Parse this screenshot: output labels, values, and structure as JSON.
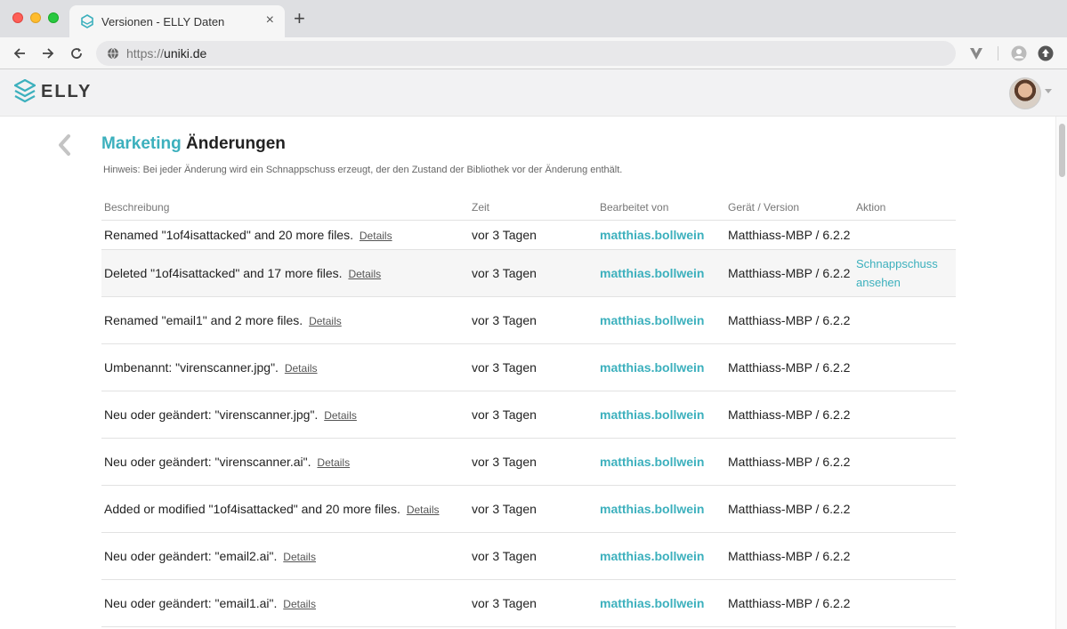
{
  "browser": {
    "tab_title": "Versionen - ELLY Daten",
    "url_scheme": "https://",
    "url_host": "uniki.de"
  },
  "app": {
    "logo_text": "ELLY"
  },
  "page": {
    "library": "Marketing",
    "title": "Änderungen",
    "hint": "Hinweis: Bei jeder Änderung wird ein Schnappschuss erzeugt, der den Zustand der Bibliothek vor der Änderung enthält."
  },
  "table": {
    "headers": {
      "description": "Beschreibung",
      "time": "Zeit",
      "editor": "Bearbeitet von",
      "device": "Gerät / Version",
      "action": "Aktion"
    },
    "details_label": "Details",
    "rows": [
      {
        "description": "Renamed \"1of4isattacked\" and 20 more files.",
        "time": "vor 3 Tagen",
        "editor": "matthias.bollwein",
        "device": "Matthiass-MBP / 6.2.2",
        "action": ""
      },
      {
        "description": "Deleted \"1of4isattacked\" and 17 more files.",
        "time": "vor 3 Tagen",
        "editor": "matthias.bollwein",
        "device": "Matthiass-MBP / 6.2.2",
        "action": "Schnappschuss ansehen"
      },
      {
        "description": "Renamed \"email1\" and 2 more files.",
        "time": "vor 3 Tagen",
        "editor": "matthias.bollwein",
        "device": "Matthiass-MBP / 6.2.2",
        "action": ""
      },
      {
        "description": "Umbenannt: \"virenscanner.jpg\".",
        "time": "vor 3 Tagen",
        "editor": "matthias.bollwein",
        "device": "Matthiass-MBP / 6.2.2",
        "action": ""
      },
      {
        "description": "Neu oder geändert: \"virenscanner.jpg\".",
        "time": "vor 3 Tagen",
        "editor": "matthias.bollwein",
        "device": "Matthiass-MBP / 6.2.2",
        "action": ""
      },
      {
        "description": "Neu oder geändert: \"virenscanner.ai\".",
        "time": "vor 3 Tagen",
        "editor": "matthias.bollwein",
        "device": "Matthiass-MBP / 6.2.2",
        "action": ""
      },
      {
        "description": "Added or modified \"1of4isattacked\" and 20 more files.",
        "time": "vor 3 Tagen",
        "editor": "matthias.bollwein",
        "device": "Matthiass-MBP / 6.2.2",
        "action": ""
      },
      {
        "description": "Neu oder geändert: \"email2.ai\".",
        "time": "vor 3 Tagen",
        "editor": "matthias.bollwein",
        "device": "Matthiass-MBP / 6.2.2",
        "action": ""
      },
      {
        "description": "Neu oder geändert: \"email1.ai\".",
        "time": "vor 3 Tagen",
        "editor": "matthias.bollwein",
        "device": "Matthiass-MBP / 6.2.2",
        "action": ""
      }
    ]
  },
  "colors": {
    "accent": "#3cb0bd",
    "header_bg": "#f2f2f3"
  },
  "icons": [
    "elly-logo-icon",
    "back-chevron-icon",
    "globe-icon",
    "reload-icon",
    "arrow-left-icon",
    "arrow-right-icon",
    "extension-icon",
    "profile-icon",
    "download-icon"
  ]
}
